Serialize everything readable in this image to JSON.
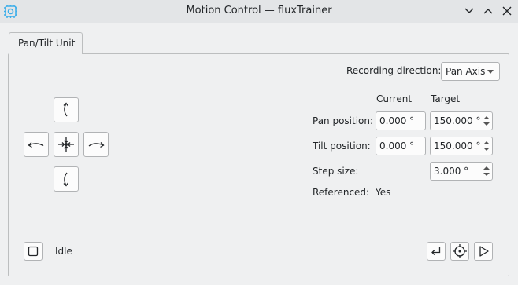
{
  "window": {
    "title": "Motion Control — fluxTrainer",
    "app_icon": "gear-chip-icon",
    "buttons": [
      "minimize-icon",
      "maximize-icon",
      "close-icon"
    ]
  },
  "tabs": [
    {
      "label": "Pan/Tilt Unit",
      "active": true
    }
  ],
  "recording": {
    "label": "Recording direction:",
    "value": "Pan Axis"
  },
  "columns": {
    "current": "Current",
    "target": "Target"
  },
  "pan": {
    "label": "Pan position:",
    "current": "0.000 °",
    "target": "150.000 °"
  },
  "tilt": {
    "label": "Tilt position:",
    "current": "0.000 °",
    "target": "150.000 °"
  },
  "step": {
    "label": "Step size:",
    "value": "3.000 °"
  },
  "referenced": {
    "label": "Referenced:",
    "value": "Yes"
  },
  "status": {
    "text": "Idle"
  },
  "direction_pad": [
    "tilt-up-icon",
    "pan-left-icon",
    "center-icon",
    "pan-right-icon",
    "tilt-down-icon"
  ],
  "action_buttons": [
    "return-icon",
    "reference-icon",
    "play-icon"
  ],
  "colors": {
    "accent": "#3daee9",
    "window_bg": "#eff0f1",
    "titlebar_bg": "#e3e5e7"
  }
}
